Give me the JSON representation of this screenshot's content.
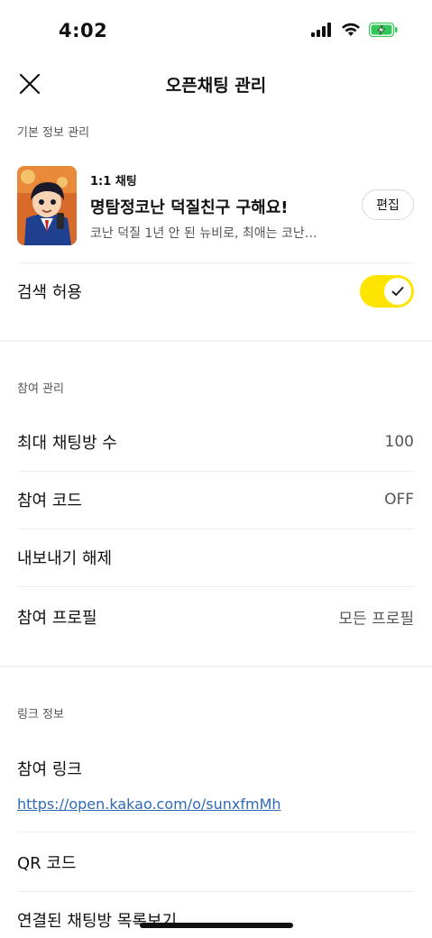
{
  "status_bar": {
    "time": "4:02",
    "icons": [
      "signal-icon",
      "wifi-icon",
      "battery-charging-icon"
    ],
    "battery_color": "#34c759"
  },
  "nav": {
    "title": "오픈채팅 관리",
    "close_icon": "close-icon"
  },
  "basic_info": {
    "header": "기본 정보 관리",
    "chat_type": "1:1 채팅",
    "chat_name": "명탐정코난 덕질친구 구해요!",
    "chat_desc": "코난 덕질 1년 안 된 뉴비로, 최애는 코난…",
    "edit_label": "편집",
    "search_allow_label": "검색 허용",
    "search_allow_on": true,
    "toggle_color": "#fee500"
  },
  "participation": {
    "header": "참여 관리",
    "rows": [
      {
        "label": "최대 채팅방 수",
        "value": "100"
      },
      {
        "label": "참여 코드",
        "value": "OFF"
      },
      {
        "label": "내보내기 해제",
        "value": ""
      },
      {
        "label": "참여 프로필",
        "value": "모든 프로필"
      }
    ]
  },
  "link_info": {
    "header": "링크 정보",
    "link_label": "참여 링크",
    "link_url": "https://open.kakao.com/o/sunxfmMh",
    "link_color": "#2e6ab8",
    "qr_label": "QR 코드",
    "linked_rooms_label": "연결된 채팅방 목록보기"
  }
}
